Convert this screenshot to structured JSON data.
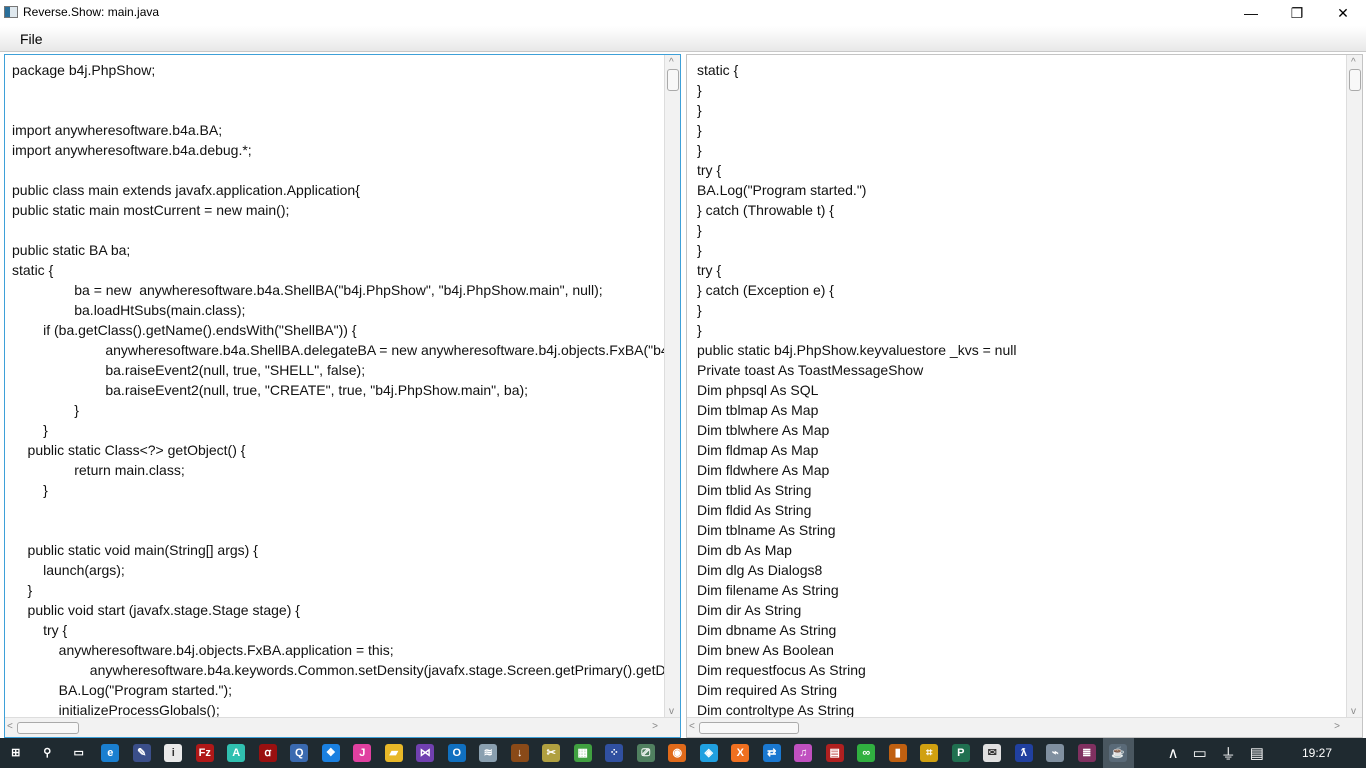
{
  "window": {
    "title": "Reverse.Show: main.java",
    "minimize": "—",
    "maximize": "❐",
    "close": "✕"
  },
  "menu": {
    "file": "File"
  },
  "left_code": [
    "package b4j.PhpShow;",
    "",
    "",
    "import anywheresoftware.b4a.BA;",
    "import anywheresoftware.b4a.debug.*;",
    "",
    "public class main extends javafx.application.Application{",
    "public static main mostCurrent = new main();",
    "",
    "public static BA ba;",
    "static {",
    "                ba = new  anywheresoftware.b4a.ShellBA(\"b4j.PhpShow\", \"b4j.PhpShow.main\", null);",
    "                ba.loadHtSubs(main.class);",
    "        if (ba.getClass().getName().endsWith(\"ShellBA\")) {",
    "                        anywheresoftware.b4a.ShellBA.delegateBA = new anywheresoftware.b4j.objects.FxBA(\"b4j.P",
    "                        ba.raiseEvent2(null, true, \"SHELL\", false);",
    "                        ba.raiseEvent2(null, true, \"CREATE\", true, \"b4j.PhpShow.main\", ba);",
    "                }",
    "        }",
    "    public static Class<?> getObject() {",
    "                return main.class;",
    "        }",
    "",
    "",
    "    public static void main(String[] args) {",
    "        launch(args);",
    "    }",
    "    public void start (javafx.stage.Stage stage) {",
    "        try {",
    "            anywheresoftware.b4j.objects.FxBA.application = this;",
    "                    anywheresoftware.b4a.keywords.Common.setDensity(javafx.stage.Screen.getPrimary().getDpi(",
    "            BA.Log(\"Program started.\");",
    "            initializeProcessGlobals();"
  ],
  "right_code": [
    "static {",
    "}",
    "}",
    "}",
    "}",
    "try {",
    "BA.Log(\"Program started.\")",
    "} catch (Throwable t) {",
    "}",
    "}",
    "try {",
    "} catch (Exception e) {",
    "}",
    "}",
    "public static b4j.PhpShow.keyvaluestore _kvs = null",
    "Private toast As ToastMessageShow",
    "Dim phpsql As SQL",
    "Dim tblmap As Map",
    "Dim tblwhere As Map",
    "Dim fldmap As Map",
    "Dim fldwhere As Map",
    "Dim tblid As String",
    "Dim fldid As String",
    "Dim tblname As String",
    "Dim db As Map",
    "Dim dlg As Dialogs8",
    "Dim filename As String",
    "Dim dir As String",
    "Dim dbname As String",
    "Dim bnew As Boolean",
    "Dim requestfocus As String",
    "Dim required As String",
    "Dim controltype As String"
  ],
  "taskbar": {
    "apps": [
      {
        "icon": "start-icon",
        "glyph": "⊞",
        "color": "transparent"
      },
      {
        "icon": "search-icon",
        "glyph": "⚲",
        "color": "transparent"
      },
      {
        "icon": "task-view-icon",
        "glyph": "▭",
        "color": "transparent"
      },
      {
        "icon": "internet-explorer-icon",
        "glyph": "e",
        "color": "#1a7fd0"
      },
      {
        "icon": "editor-icon",
        "glyph": "✎",
        "color": "#3b4f8a"
      },
      {
        "icon": "info-icon",
        "glyph": "i",
        "color": "#eaeaea"
      },
      {
        "icon": "filezilla-icon",
        "glyph": "Fz",
        "color": "#b01818"
      },
      {
        "icon": "a-app-icon",
        "glyph": "A",
        "color": "#30c0b0"
      },
      {
        "icon": "acrobat-icon",
        "glyph": "ꭤ",
        "color": "#9a1010"
      },
      {
        "icon": "quicktime-icon",
        "glyph": "Q",
        "color": "#3a6ab0"
      },
      {
        "icon": "dropbox-icon",
        "glyph": "❖",
        "color": "#1a80e0"
      },
      {
        "icon": "j-app-icon",
        "glyph": "J",
        "color": "#e040a0"
      },
      {
        "icon": "file-explorer-icon",
        "glyph": "▰",
        "color": "#e8b828"
      },
      {
        "icon": "visual-studio-icon",
        "glyph": "⋈",
        "color": "#7040b0"
      },
      {
        "icon": "outlook-icon",
        "glyph": "O",
        "color": "#1070c0"
      },
      {
        "icon": "database-icon",
        "glyph": "≋",
        "color": "#8aa0b0"
      },
      {
        "icon": "download-icon",
        "glyph": "↓",
        "color": "#8a4a18"
      },
      {
        "icon": "tools-icon",
        "glyph": "✂",
        "color": "#b0a040"
      },
      {
        "icon": "blocks-icon",
        "glyph": "▦",
        "color": "#40a040"
      },
      {
        "icon": "grid-app-icon",
        "glyph": "⁘",
        "color": "#3050a0"
      },
      {
        "icon": "remote-icon",
        "glyph": "⎚",
        "color": "#508060"
      },
      {
        "icon": "firefox-icon",
        "glyph": "◉",
        "color": "#e06a1a"
      },
      {
        "icon": "app-blue-icon",
        "glyph": "◈",
        "color": "#20a0e0"
      },
      {
        "icon": "xampp-icon",
        "glyph": "X",
        "color": "#f07020"
      },
      {
        "icon": "teamviewer-icon",
        "glyph": "⇄",
        "color": "#1a78d0"
      },
      {
        "icon": "itunes-icon",
        "glyph": "♫",
        "color": "#c050c0"
      },
      {
        "icon": "toolbox-icon",
        "glyph": "▤",
        "color": "#b02020"
      },
      {
        "icon": "chat-icon",
        "glyph": "∞",
        "color": "#30b040"
      },
      {
        "icon": "book-icon",
        "glyph": "▮",
        "color": "#c06010"
      },
      {
        "icon": "network-icon",
        "glyph": "⌗",
        "color": "#d0a010"
      },
      {
        "icon": "project-icon",
        "glyph": "P",
        "color": "#207050"
      },
      {
        "icon": "pdf-icon",
        "glyph": "✉",
        "color": "#e0e0e0"
      },
      {
        "icon": "feather-icon",
        "glyph": "ƛ",
        "color": "#2040a0"
      },
      {
        "icon": "monitor-icon",
        "glyph": "⌁",
        "color": "#8090a0"
      },
      {
        "icon": "winrar-icon",
        "glyph": "≣",
        "color": "#803060"
      },
      {
        "icon": "java-icon",
        "glyph": "☕",
        "color": "#5a6a78"
      }
    ],
    "tray_icons": [
      "chevron-up-icon",
      "battery-icon",
      "usb-icon",
      "notifications-icon"
    ],
    "tray_glyphs": [
      "∧",
      "▭",
      "⏚",
      "▤"
    ],
    "clock": "19:27"
  }
}
